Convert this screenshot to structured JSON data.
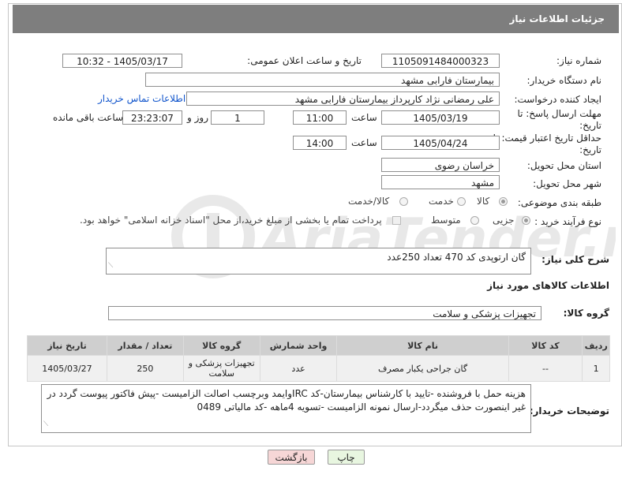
{
  "header": {
    "title": "جزئیات اطلاعات نیاز"
  },
  "labels": {
    "need_number": "شماره نیاز:",
    "announce_datetime": "تاریخ و ساعت اعلان عمومی:",
    "buyer_org": "نام دستگاه خریدار:",
    "requester": "ایجاد کننده درخواست:",
    "contact_link": "اطلاعات تماس خریدار",
    "reply_deadline": "مهلت ارسال پاسخ: تا تاریخ:",
    "time": "ساعت",
    "day_and": "روز و",
    "remaining": "ساعت باقی مانده",
    "price_validity": "حداقل تاریخ اعتبار قیمت: تا تاریخ:",
    "time2": "ساعت",
    "province": "استان محل تحویل:",
    "city": "شهر محل تحویل:",
    "category": "طبقه بندی موضوعی:",
    "process_type": "نوع فرآیند خرید :",
    "summary": "شرح کلی نیاز:",
    "goods_info": "اطلاعات کالاهای مورد نیاز",
    "goods_group": "گروه کالا:",
    "buyer_notes": "توضیحات خریدار:"
  },
  "values": {
    "need_number": "1105091484000323",
    "announce_datetime": "1405/03/17 - 10:32",
    "buyer_org": "بیمارستان فارابی مشهد",
    "requester": "علی رمضانی نژاد کارپرداز بیمارستان فارابی مشهد",
    "reply_date": "1405/03/19",
    "reply_time": "11:00",
    "reply_days": "1",
    "reply_remaining": "23:23:07",
    "validity_date": "1405/04/24",
    "validity_time": "14:00",
    "province": "خراسان رضوی",
    "city": "مشهد",
    "summary": "گان ارتوپدی کد 470    تعداد 250عدد",
    "goods_group": "تجهیزات پزشکی و سلامت",
    "buyer_notes": "هزینه حمل با فروشنده -تایید با کارشناس بیمارستان-کد IRCوایمد وبرچسب اصالت الزامیست -پیش فاکتور پیوست گردد در غیر اینصورت حذف میگردد-ارسال نمونه الزامیست -تسویه 4ماهه -کد مالیاتی 0489"
  },
  "category_options": [
    {
      "label": "کالا",
      "selected": true
    },
    {
      "label": "خدمت",
      "selected": false
    },
    {
      "label": "کالا/خدمت",
      "selected": false
    }
  ],
  "process_options": [
    {
      "label": "جزیی",
      "selected": true
    },
    {
      "label": "متوسط",
      "selected": false
    }
  ],
  "payment_note": "پرداخت تمام یا بخشی از مبلغ خرید،از محل \"اسناد خزانه اسلامی\" خواهد بود.",
  "table": {
    "headers": [
      "ردیف",
      "کد کالا",
      "نام کالا",
      "واحد شمارش",
      "گروه کالا",
      "تعداد / مقدار",
      "تاریخ نیاز"
    ],
    "rows": [
      [
        "1",
        "--",
        "گان جراحی یکبار مصرف",
        "عدد",
        "تجهیزات پزشکی و سلامت",
        "250",
        "1405/03/27"
      ]
    ]
  },
  "buttons": {
    "print": "چاپ",
    "back": "بازگشت"
  },
  "watermark": "AriaTender.net",
  "colors": {
    "header_bg": "#7e7e7e",
    "link": "#1155cc",
    "back_btn": "#f6d6d6",
    "print_btn": "#e8f6e0"
  }
}
